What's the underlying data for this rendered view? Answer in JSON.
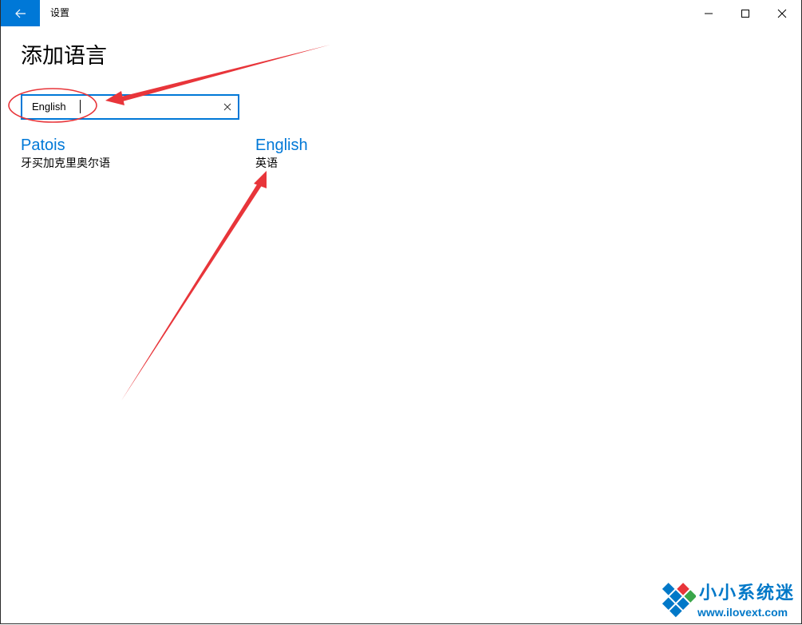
{
  "window": {
    "title": "设置",
    "back_icon": "back-arrow-icon",
    "controls": {
      "minimize": "minimize-icon",
      "maximize": "maximize-icon",
      "close": "close-icon"
    }
  },
  "page": {
    "title": "添加语言"
  },
  "search": {
    "value": "English",
    "clear_icon": "clear-x-icon"
  },
  "results": [
    {
      "name": "Patois",
      "native": "牙买加克里奥尔语"
    },
    {
      "name": "English",
      "native": "英语"
    }
  ],
  "watermark": {
    "brand": "小小系统迷",
    "url": "www.ilovext.com"
  },
  "colors": {
    "accent": "#0078d7",
    "annotation": "#e8353a"
  }
}
